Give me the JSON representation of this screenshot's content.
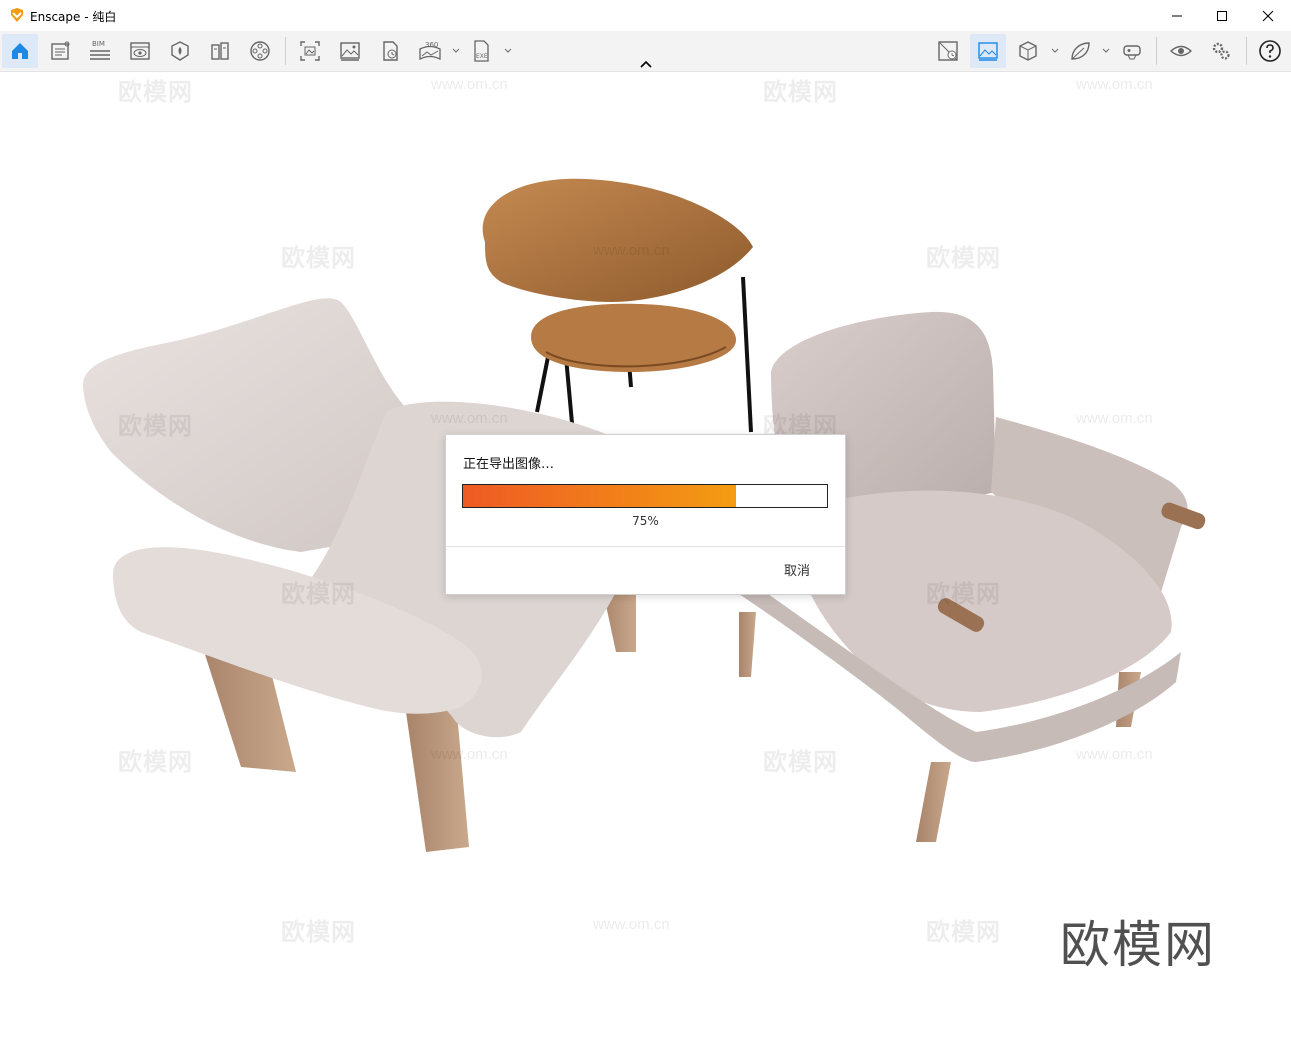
{
  "window": {
    "app_name": "Enscape",
    "title": "Enscape - 纯白",
    "controls": [
      "minimize-icon",
      "maximize-icon",
      "close-icon"
    ]
  },
  "toolbar": {
    "left_icons": [
      "home-icon",
      "project-notes-icon",
      "bim-icon",
      "view-icon",
      "asset-library-icon",
      "material-editor-icon",
      "video-editor-icon",
      "screenshot-icon",
      "render-image-icon",
      "batch-render-icon",
      "panorama-360-icon",
      "exe-export-icon"
    ],
    "right_icons": [
      "views-manager-icon",
      "visual-settings-icon",
      "cube-view-icon",
      "atmosphere-icon",
      "vr-headset-icon",
      "eye-icon",
      "settings-icon",
      "help-icon"
    ],
    "bim_label": "BIM",
    "panorama_label": "360",
    "exe_label": "EXE",
    "accent_color": "#1e88e5"
  },
  "watermark": {
    "brand": "欧模网",
    "url": "www.om.cn"
  },
  "dialog": {
    "title": "正在导出图像…",
    "progress": 0.75,
    "progress_text": "75%",
    "cancel_label": "取消",
    "gradient_start": "#ee5a24",
    "gradient_end": "#f39c12"
  }
}
